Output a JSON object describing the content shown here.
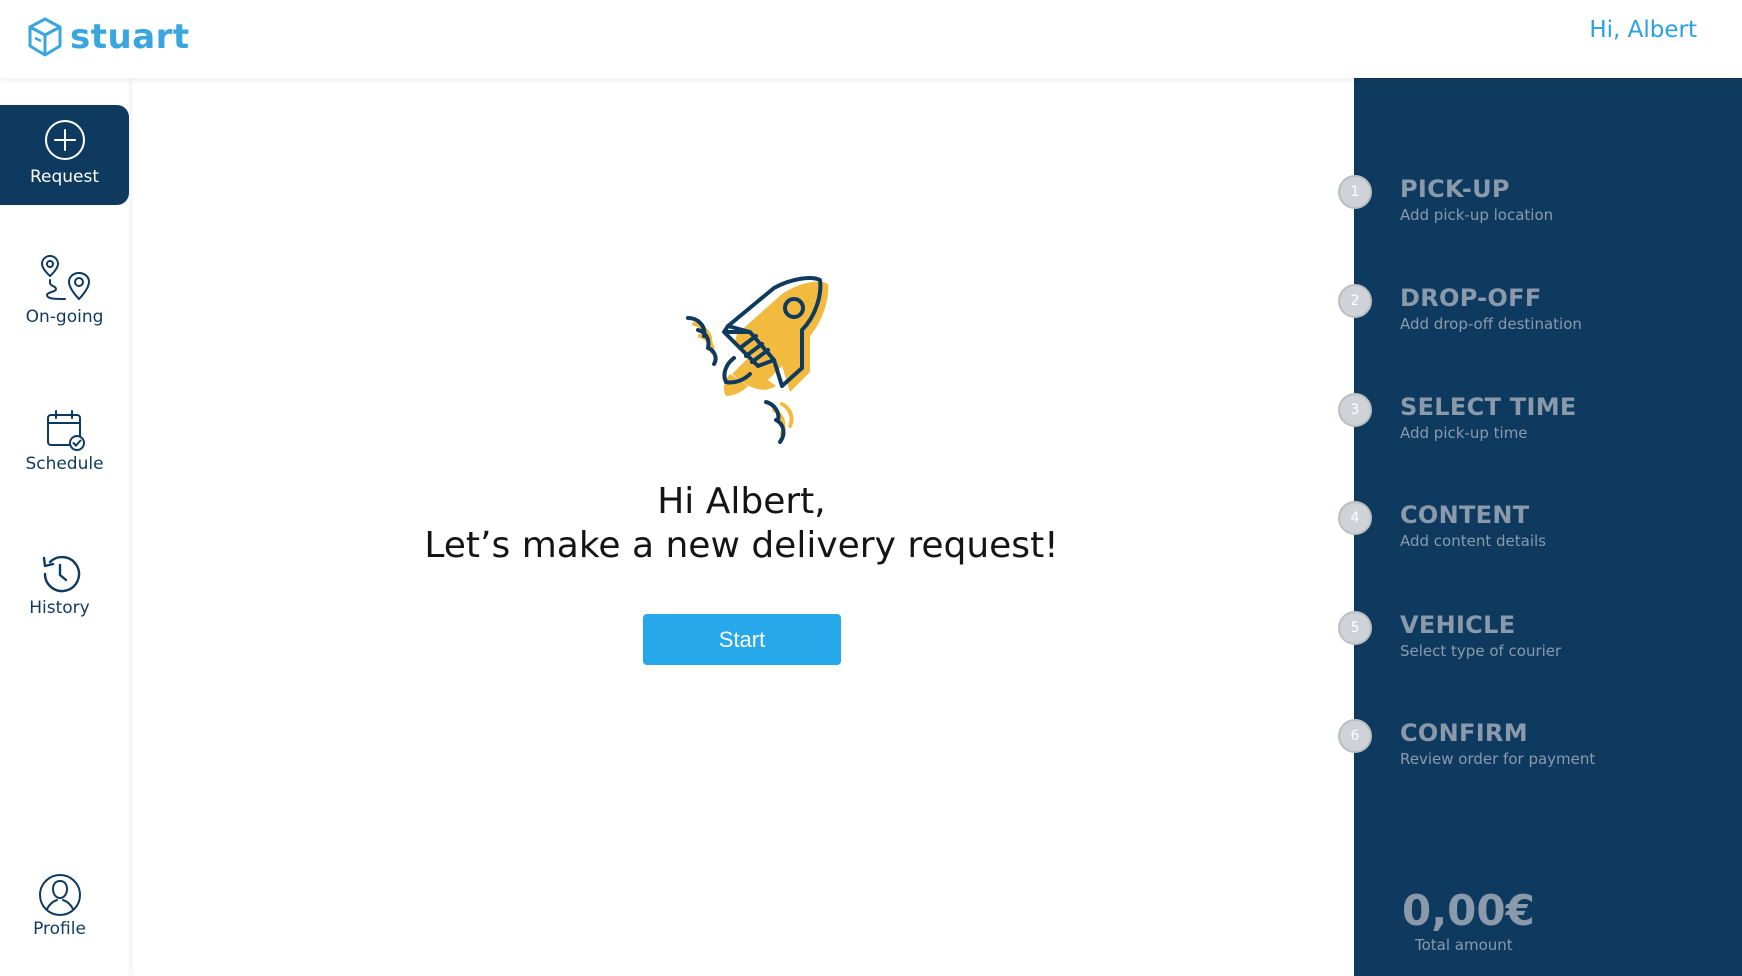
{
  "header": {
    "logo_text": "stuart",
    "greeting": "Hi, Albert"
  },
  "sidebar": {
    "items": [
      {
        "label": "Request",
        "icon": "plus-circle-icon",
        "active": true
      },
      {
        "label": "On-going",
        "icon": "route-pins-icon",
        "active": false
      },
      {
        "label": "Schedule",
        "icon": "calendar-check-icon",
        "active": false
      },
      {
        "label": "History",
        "icon": "history-clock-icon",
        "active": false
      },
      {
        "label": "Profile",
        "icon": "user-circle-icon",
        "active": false
      }
    ]
  },
  "main": {
    "illustration": "rocket-icon",
    "headline_line1": "Hi Albert,",
    "headline_line2": "Let’s make a new delivery request!",
    "start_label": "Start"
  },
  "steps": [
    {
      "num": "1",
      "title": "PICK-UP",
      "subtitle": "Add pick-up location"
    },
    {
      "num": "2",
      "title": "DROP-OFF",
      "subtitle": "Add drop-off destination"
    },
    {
      "num": "3",
      "title": "SELECT TIME",
      "subtitle": "Add pick-up time"
    },
    {
      "num": "4",
      "title": "CONTENT",
      "subtitle": "Add content details"
    },
    {
      "num": "5",
      "title": "VEHICLE",
      "subtitle": "Select type of courier"
    },
    {
      "num": "6",
      "title": "CONFIRM",
      "subtitle": "Review order for payment"
    }
  ],
  "summary": {
    "total_amount": "0,00€",
    "total_label": "Total amount"
  },
  "colors": {
    "navy": "#0f3a5f",
    "brand_blue": "#3aa6df",
    "button_blue": "#27a8ea",
    "rocket_yellow": "#f2bb3f",
    "muted": "#8a9aab"
  }
}
